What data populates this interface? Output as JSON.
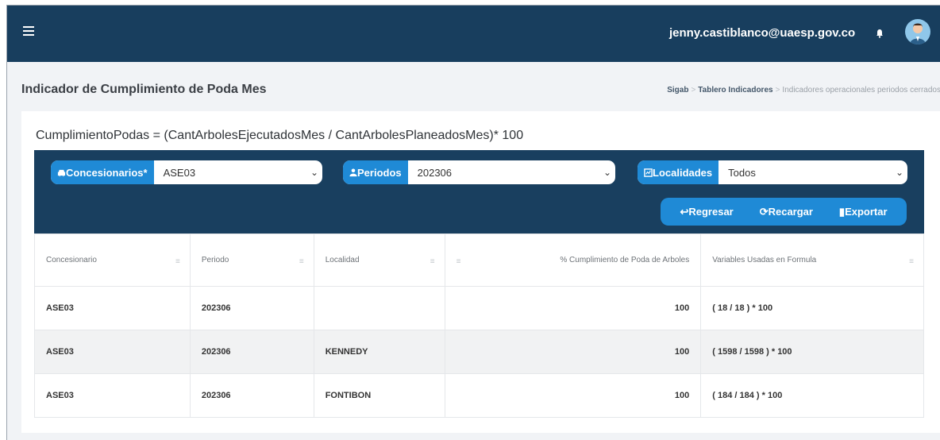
{
  "topbar": {
    "user_email": "jenny.castiblanco@uaesp.gov.co",
    "icons": [
      "menu-icon",
      "bell-icon",
      "avatar"
    ]
  },
  "header": {
    "title": "Indicador de Cumplimiento de Poda Mes",
    "breadcrumb": [
      "Sigab",
      "Tablero Indicadores",
      "Indicadores operacionales periodos cerrados"
    ]
  },
  "formula": "CumplimientoPodas = (CantArbolesEjecutadosMes / CantArbolesPlaneadosMes)* 100",
  "filters": {
    "concesionarios": {
      "label": "Concesionarios*",
      "value": "ASE03",
      "icon": "car-icon"
    },
    "periodos": {
      "label": "Periodos",
      "value": "202306",
      "icon": "user-icon"
    },
    "localidades": {
      "label": "Localidades",
      "value": "Todos",
      "icon": "map-icon"
    }
  },
  "buttons": {
    "regresar": "Regresar",
    "recargar": "Recargar",
    "exportar": "Exportar"
  },
  "table": {
    "headers": [
      "Concesionario",
      "Periodo",
      "Localidad",
      "% Cumplimiento de Poda de Arboles",
      "Variables Usadas en Formula"
    ],
    "rows": [
      [
        "ASE03",
        "202306",
        "",
        "100",
        "( 18 / 18 ) * 100"
      ],
      [
        "ASE03",
        "202306",
        "KENNEDY",
        "100",
        "( 1598 / 1598 ) * 100"
      ],
      [
        "ASE03",
        "202306",
        "FONTIBON",
        "100",
        "( 184 / 184 ) * 100"
      ]
    ]
  },
  "colors": {
    "navy": "#183e5e",
    "blue": "#1f8ad6"
  }
}
